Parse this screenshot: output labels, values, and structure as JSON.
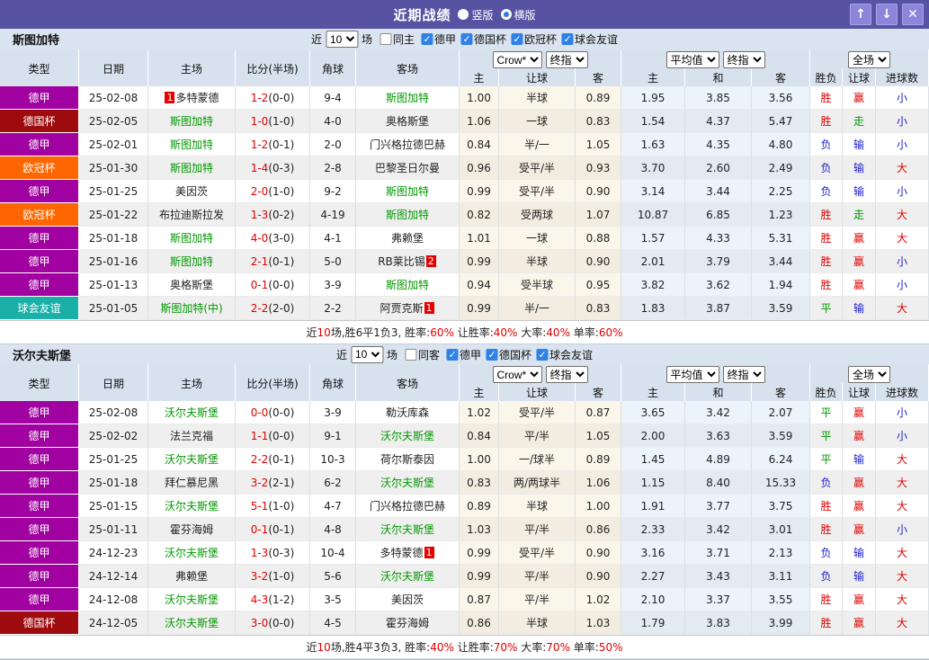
{
  "title_bar": {
    "title": "近期战绩",
    "radio_vertical": "竖版",
    "radio_horizontal": "横版",
    "icons": {
      "up": "↑",
      "down": "↓",
      "close": "✕"
    }
  },
  "colors": {
    "titlebar": "#5753a3",
    "accent_button": "#8c85db",
    "team_highlight": "#009900",
    "score_red": "#e00000",
    "types": {
      "德甲": "#a101a1",
      "德国杯": "#9e0b0f",
      "欧冠杯": "#ff6600",
      "球会友谊": "#1ab0a8"
    },
    "result_classes": {
      "胜": "red",
      "平": "green",
      "负": "blue",
      "赢": "red",
      "走": "green",
      "输": "blue",
      "大": "red",
      "小": "blue"
    }
  },
  "filters": {
    "near": "近",
    "count": "10",
    "games": "场"
  },
  "header": {
    "cols": {
      "type": "类型",
      "date": "日期",
      "home": "主场",
      "score": "比分(半场)",
      "corner": "角球",
      "away": "客场"
    },
    "selects": [
      "Crow*",
      "终指",
      "平均值",
      "终指",
      "全场"
    ],
    "sub": [
      "主",
      "让球",
      "客",
      "主",
      "和",
      "客",
      "胜负",
      "让球",
      "进球数"
    ]
  },
  "sections": [
    {
      "team": "斯图加特",
      "same_label": "同主",
      "leagues": [
        "德甲",
        "德国杯",
        "欧冠杯",
        "球会友谊"
      ],
      "rows": [
        {
          "type": "德甲",
          "date": "25-02-08",
          "home": {
            "name": "多特蒙德",
            "green": false,
            "badge": "1",
            "side": "left"
          },
          "score": "1-2",
          "half": "(0-0)",
          "corner": "9-4",
          "away": {
            "name": "斯图加特",
            "green": true
          },
          "odds": [
            "1.00",
            "半球",
            "0.89"
          ],
          "avg": [
            "1.95",
            "3.85",
            "3.56"
          ],
          "result": [
            "胜",
            "赢",
            "小"
          ]
        },
        {
          "type": "德国杯",
          "date": "25-02-05",
          "home": {
            "name": "斯图加特",
            "green": true
          },
          "score": "1-0",
          "half": "(1-0)",
          "corner": "4-0",
          "away": {
            "name": "奥格斯堡",
            "green": false
          },
          "odds": [
            "1.06",
            "一球",
            "0.83"
          ],
          "avg": [
            "1.54",
            "4.37",
            "5.47"
          ],
          "result": [
            "胜",
            "走",
            "小"
          ]
        },
        {
          "type": "德甲",
          "date": "25-02-01",
          "home": {
            "name": "斯图加特",
            "green": true
          },
          "score": "1-2",
          "half": "(0-1)",
          "corner": "2-0",
          "away": {
            "name": "门兴格拉德巴赫",
            "green": false
          },
          "odds": [
            "0.84",
            "半/一",
            "1.05"
          ],
          "avg": [
            "1.63",
            "4.35",
            "4.80"
          ],
          "result": [
            "负",
            "输",
            "小"
          ]
        },
        {
          "type": "欧冠杯",
          "date": "25-01-30",
          "home": {
            "name": "斯图加特",
            "green": true
          },
          "score": "1-4",
          "half": "(0-3)",
          "corner": "2-8",
          "away": {
            "name": "巴黎圣日尔曼",
            "green": false
          },
          "odds": [
            "0.96",
            "受平/半",
            "0.93"
          ],
          "avg": [
            "3.70",
            "2.60",
            "2.49"
          ],
          "result": [
            "负",
            "输",
            "大"
          ]
        },
        {
          "type": "德甲",
          "date": "25-01-25",
          "home": {
            "name": "美因茨",
            "green": false
          },
          "score": "2-0",
          "half": "(1-0)",
          "corner": "9-2",
          "away": {
            "name": "斯图加特",
            "green": true
          },
          "odds": [
            "0.99",
            "受平/半",
            "0.90"
          ],
          "avg": [
            "3.14",
            "3.44",
            "2.25"
          ],
          "result": [
            "负",
            "输",
            "小"
          ]
        },
        {
          "type": "欧冠杯",
          "date": "25-01-22",
          "home": {
            "name": "布拉迪斯拉发",
            "green": false
          },
          "score": "1-3",
          "half": "(0-2)",
          "corner": "4-19",
          "away": {
            "name": "斯图加特",
            "green": true
          },
          "odds": [
            "0.82",
            "受两球",
            "1.07"
          ],
          "avg": [
            "10.87",
            "6.85",
            "1.23"
          ],
          "result": [
            "胜",
            "走",
            "大"
          ]
        },
        {
          "type": "德甲",
          "date": "25-01-18",
          "home": {
            "name": "斯图加特",
            "green": true
          },
          "score": "4-0",
          "half": "(3-0)",
          "corner": "4-1",
          "away": {
            "name": "弗赖堡",
            "green": false
          },
          "odds": [
            "1.01",
            "一球",
            "0.88"
          ],
          "avg": [
            "1.57",
            "4.33",
            "5.31"
          ],
          "result": [
            "胜",
            "赢",
            "大"
          ]
        },
        {
          "type": "德甲",
          "date": "25-01-16",
          "home": {
            "name": "斯图加特",
            "green": true
          },
          "score": "2-1",
          "half": "(0-1)",
          "corner": "5-0",
          "away": {
            "name": "RB莱比锡",
            "green": false,
            "badge": "2",
            "side": "right"
          },
          "odds": [
            "0.99",
            "半球",
            "0.90"
          ],
          "avg": [
            "2.01",
            "3.79",
            "3.44"
          ],
          "result": [
            "胜",
            "赢",
            "小"
          ]
        },
        {
          "type": "德甲",
          "date": "25-01-13",
          "home": {
            "name": "奥格斯堡",
            "green": false
          },
          "score": "0-1",
          "half": "(0-0)",
          "corner": "3-9",
          "away": {
            "name": "斯图加特",
            "green": true
          },
          "odds": [
            "0.94",
            "受半球",
            "0.95"
          ],
          "avg": [
            "3.82",
            "3.62",
            "1.94"
          ],
          "result": [
            "胜",
            "赢",
            "小"
          ]
        },
        {
          "type": "球会友谊",
          "date": "25-01-05",
          "home": {
            "name": "斯图加特(中)",
            "green": true
          },
          "score": "2-2",
          "half": "(2-0)",
          "corner": "2-2",
          "away": {
            "name": "阿贾克斯",
            "green": false,
            "badge": "1",
            "side": "right"
          },
          "odds": [
            "0.99",
            "半/一",
            "0.83"
          ],
          "avg": [
            "1.83",
            "3.87",
            "3.59"
          ],
          "result": [
            "平",
            "输",
            "大"
          ]
        }
      ],
      "summary": [
        {
          "t": "近",
          "r": false
        },
        {
          "t": "10",
          "r": true
        },
        {
          "t": "场,胜6平1负3, 胜率:",
          "r": false
        },
        {
          "t": "60%",
          "r": true
        },
        {
          "t": " 让胜率:",
          "r": false
        },
        {
          "t": "40%",
          "r": true
        },
        {
          "t": " 大率:",
          "r": false
        },
        {
          "t": "40%",
          "r": true
        },
        {
          "t": " 单率:",
          "r": false
        },
        {
          "t": "60%",
          "r": true
        }
      ]
    },
    {
      "team": "沃尔夫斯堡",
      "same_label": "同客",
      "leagues": [
        "德甲",
        "德国杯",
        "球会友谊"
      ],
      "rows": [
        {
          "type": "德甲",
          "date": "25-02-08",
          "home": {
            "name": "沃尔夫斯堡",
            "green": true
          },
          "score": "0-0",
          "half": "(0-0)",
          "corner": "3-9",
          "away": {
            "name": "勒沃库森",
            "green": false
          },
          "odds": [
            "1.02",
            "受平/半",
            "0.87"
          ],
          "avg": [
            "3.65",
            "3.42",
            "2.07"
          ],
          "result": [
            "平",
            "赢",
            "小"
          ]
        },
        {
          "type": "德甲",
          "date": "25-02-02",
          "home": {
            "name": "法兰克福",
            "green": false
          },
          "score": "1-1",
          "half": "(0-0)",
          "corner": "9-1",
          "away": {
            "name": "沃尔夫斯堡",
            "green": true
          },
          "odds": [
            "0.84",
            "平/半",
            "1.05"
          ],
          "avg": [
            "2.00",
            "3.63",
            "3.59"
          ],
          "result": [
            "平",
            "赢",
            "小"
          ]
        },
        {
          "type": "德甲",
          "date": "25-01-25",
          "home": {
            "name": "沃尔夫斯堡",
            "green": true
          },
          "score": "2-2",
          "half": "(0-1)",
          "corner": "10-3",
          "away": {
            "name": "荷尔斯泰因",
            "green": false
          },
          "odds": [
            "1.00",
            "一/球半",
            "0.89"
          ],
          "avg": [
            "1.45",
            "4.89",
            "6.24"
          ],
          "result": [
            "平",
            "输",
            "大"
          ]
        },
        {
          "type": "德甲",
          "date": "25-01-18",
          "home": {
            "name": "拜仁慕尼黑",
            "green": false
          },
          "score": "3-2",
          "half": "(2-1)",
          "corner": "6-2",
          "away": {
            "name": "沃尔夫斯堡",
            "green": true
          },
          "odds": [
            "0.83",
            "两/两球半",
            "1.06"
          ],
          "avg": [
            "1.15",
            "8.40",
            "15.33"
          ],
          "result": [
            "负",
            "赢",
            "大"
          ]
        },
        {
          "type": "德甲",
          "date": "25-01-15",
          "home": {
            "name": "沃尔夫斯堡",
            "green": true
          },
          "score": "5-1",
          "half": "(1-0)",
          "corner": "4-7",
          "away": {
            "name": "门兴格拉德巴赫",
            "green": false
          },
          "odds": [
            "0.89",
            "半球",
            "1.00"
          ],
          "avg": [
            "1.91",
            "3.77",
            "3.75"
          ],
          "result": [
            "胜",
            "赢",
            "大"
          ]
        },
        {
          "type": "德甲",
          "date": "25-01-11",
          "home": {
            "name": "霍芬海姆",
            "green": false
          },
          "score": "0-1",
          "half": "(0-1)",
          "corner": "4-8",
          "away": {
            "name": "沃尔夫斯堡",
            "green": true
          },
          "odds": [
            "1.03",
            "平/半",
            "0.86"
          ],
          "avg": [
            "2.33",
            "3.42",
            "3.01"
          ],
          "result": [
            "胜",
            "赢",
            "小"
          ]
        },
        {
          "type": "德甲",
          "date": "24-12-23",
          "home": {
            "name": "沃尔夫斯堡",
            "green": true
          },
          "score": "1-3",
          "half": "(0-3)",
          "corner": "10-4",
          "away": {
            "name": "多特蒙德",
            "green": false,
            "badge": "1",
            "side": "right"
          },
          "odds": [
            "0.99",
            "受平/半",
            "0.90"
          ],
          "avg": [
            "3.16",
            "3.71",
            "2.13"
          ],
          "result": [
            "负",
            "输",
            "大"
          ]
        },
        {
          "type": "德甲",
          "date": "24-12-14",
          "home": {
            "name": "弗赖堡",
            "green": false
          },
          "score": "3-2",
          "half": "(1-0)",
          "corner": "5-6",
          "away": {
            "name": "沃尔夫斯堡",
            "green": true
          },
          "odds": [
            "0.99",
            "平/半",
            "0.90"
          ],
          "avg": [
            "2.27",
            "3.43",
            "3.11"
          ],
          "result": [
            "负",
            "输",
            "大"
          ]
        },
        {
          "type": "德甲",
          "date": "24-12-08",
          "home": {
            "name": "沃尔夫斯堡",
            "green": true
          },
          "score": "4-3",
          "half": "(1-2)",
          "corner": "3-5",
          "away": {
            "name": "美因茨",
            "green": false
          },
          "odds": [
            "0.87",
            "平/半",
            "1.02"
          ],
          "avg": [
            "2.10",
            "3.37",
            "3.55"
          ],
          "result": [
            "胜",
            "赢",
            "大"
          ]
        },
        {
          "type": "德国杯",
          "date": "24-12-05",
          "home": {
            "name": "沃尔夫斯堡",
            "green": true
          },
          "score": "3-0",
          "half": "(0-0)",
          "corner": "4-5",
          "away": {
            "name": "霍芬海姆",
            "green": false
          },
          "odds": [
            "0.86",
            "半球",
            "1.03"
          ],
          "avg": [
            "1.79",
            "3.83",
            "3.99"
          ],
          "result": [
            "胜",
            "赢",
            "大"
          ]
        }
      ],
      "summary": [
        {
          "t": "近",
          "r": false
        },
        {
          "t": "10",
          "r": true
        },
        {
          "t": "场,胜4平3负3, 胜率:",
          "r": false
        },
        {
          "t": "40%",
          "r": true
        },
        {
          "t": " 让胜率:",
          "r": false
        },
        {
          "t": "70%",
          "r": true
        },
        {
          "t": " 大率:",
          "r": false
        },
        {
          "t": "70%",
          "r": true
        },
        {
          "t": " 单率:",
          "r": false
        },
        {
          "t": "50%",
          "r": true
        }
      ]
    }
  ]
}
